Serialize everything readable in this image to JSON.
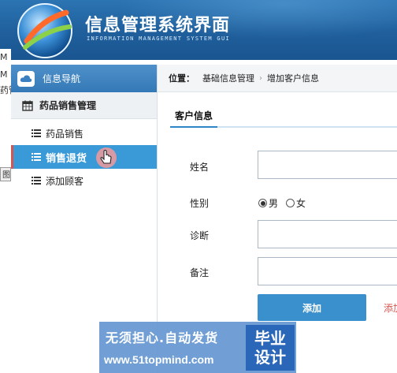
{
  "header": {
    "title": "信息管理系统界面",
    "subtitle": "INFORMATION MANAGEMENT SYSTEM GUI"
  },
  "background_window": {
    "fragments": [
      "M",
      "M 图",
      "药管",
      "图"
    ]
  },
  "sidebar": {
    "nav_title": "信息导航",
    "group_label": "药品销售管理",
    "items": [
      {
        "label": "药品销售",
        "active": false
      },
      {
        "label": "销售退货",
        "active": true
      },
      {
        "label": "添加顾客",
        "active": false
      }
    ]
  },
  "breadcrumb": {
    "label": "位置：",
    "parent": "基础信息管理",
    "current": "增加客户信息"
  },
  "form": {
    "tab": "客户信息",
    "name_label": "姓名",
    "gender_label": "性别",
    "gender_options": [
      {
        "label": "男",
        "checked": true
      },
      {
        "label": "女",
        "checked": false
      }
    ],
    "diagnosis_label": "诊断",
    "note_label": "备注",
    "name_value": "",
    "diagnosis_value": "",
    "note_value": "",
    "submit_label": "添加",
    "secondary_link": "添加"
  },
  "watermark": {
    "line1": "无须担心.自动发货",
    "line2": "www.51topmind.com",
    "box_line1": "毕业",
    "box_line2": "设计"
  },
  "colors": {
    "header_blue": "#1f5f9c",
    "sidebar_active": "#3a9ad8",
    "button_blue": "#3a90cc",
    "accent_red": "#d9534f"
  }
}
